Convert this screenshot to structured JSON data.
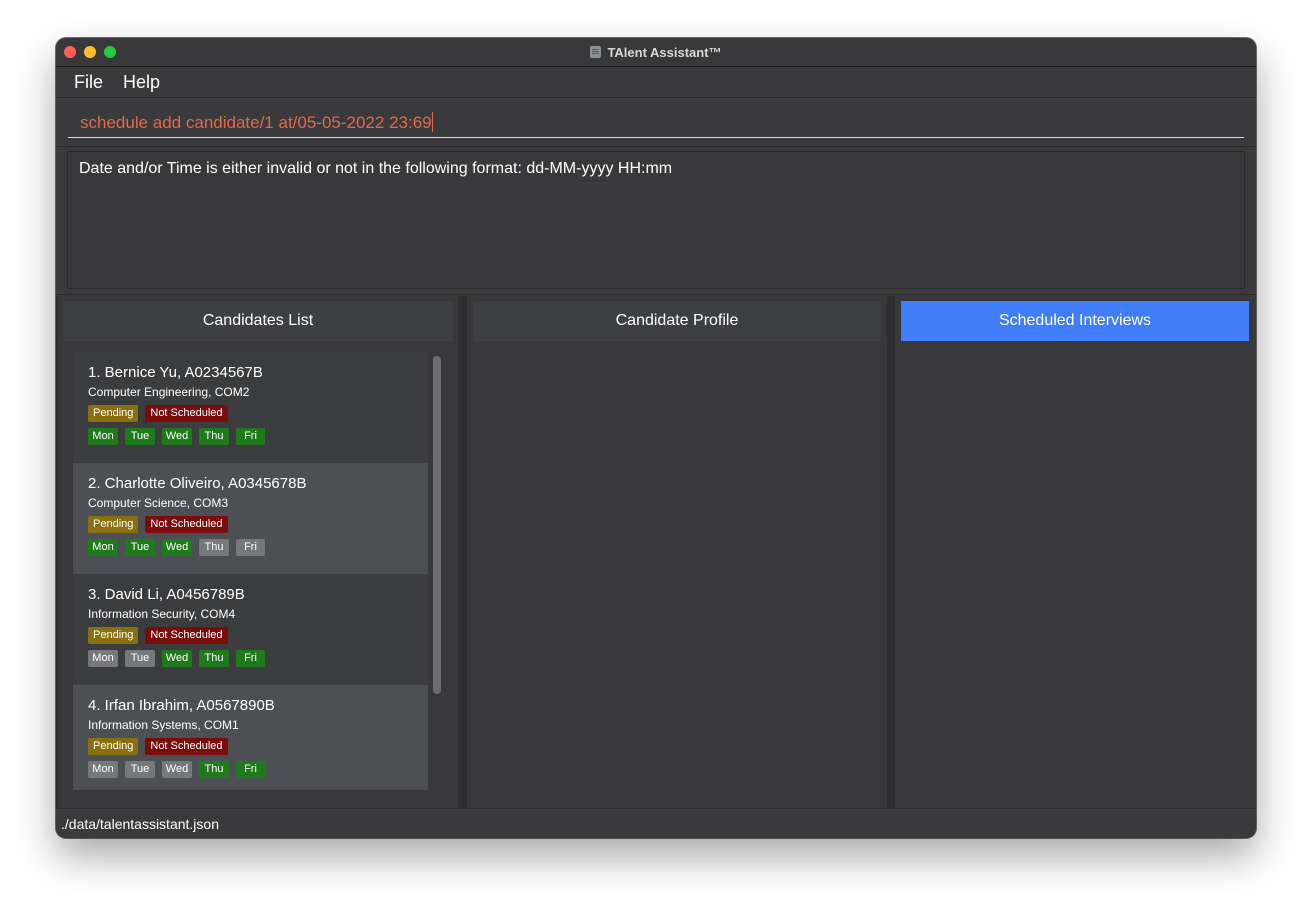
{
  "window": {
    "title": "TAlent Assistant™"
  },
  "menu": [
    "File",
    "Help"
  ],
  "command_box": {
    "value": "schedule add candidate/1 at/05-05-2022 23:69",
    "error_color": "#e0684b"
  },
  "result_display": {
    "message": "Date and/or Time is either invalid or not in the following format: dd-MM-yyyy HH:mm"
  },
  "panels": {
    "candidates_list": "Candidates List",
    "candidate_profile": "Candidate Profile",
    "scheduled_interviews": "Scheduled Interviews",
    "active_accent": "#3f7ef8"
  },
  "candidates": [
    {
      "title": "1.  Bernice Yu, A0234567B",
      "course": "Computer Engineering, COM2",
      "application_status": "Pending",
      "interview_status": "Not Scheduled",
      "days": [
        {
          "label": "Mon",
          "available": true
        },
        {
          "label": "Tue",
          "available": true
        },
        {
          "label": "Wed",
          "available": true
        },
        {
          "label": "Thu",
          "available": true
        },
        {
          "label": "Fri",
          "available": true
        }
      ]
    },
    {
      "title": "2.  Charlotte Oliveiro, A0345678B",
      "course": "Computer Science, COM3",
      "application_status": "Pending",
      "interview_status": "Not Scheduled",
      "days": [
        {
          "label": "Mon",
          "available": true
        },
        {
          "label": "Tue",
          "available": true
        },
        {
          "label": "Wed",
          "available": true
        },
        {
          "label": "Thu",
          "available": false
        },
        {
          "label": "Fri",
          "available": false
        }
      ]
    },
    {
      "title": "3.  David Li, A0456789B",
      "course": "Information Security, COM4",
      "application_status": "Pending",
      "interview_status": "Not Scheduled",
      "days": [
        {
          "label": "Mon",
          "available": false
        },
        {
          "label": "Tue",
          "available": false
        },
        {
          "label": "Wed",
          "available": true
        },
        {
          "label": "Thu",
          "available": true
        },
        {
          "label": "Fri",
          "available": true
        }
      ]
    },
    {
      "title": "4.  Irfan Ibrahim, A0567890B",
      "course": "Information Systems, COM1",
      "application_status": "Pending",
      "interview_status": "Not Scheduled",
      "days": [
        {
          "label": "Mon",
          "available": false
        },
        {
          "label": "Tue",
          "available": false
        },
        {
          "label": "Wed",
          "available": false
        },
        {
          "label": "Thu",
          "available": true
        },
        {
          "label": "Fri",
          "available": true
        }
      ]
    }
  ],
  "status_bar": {
    "path": "./data/talentassistant.json"
  }
}
